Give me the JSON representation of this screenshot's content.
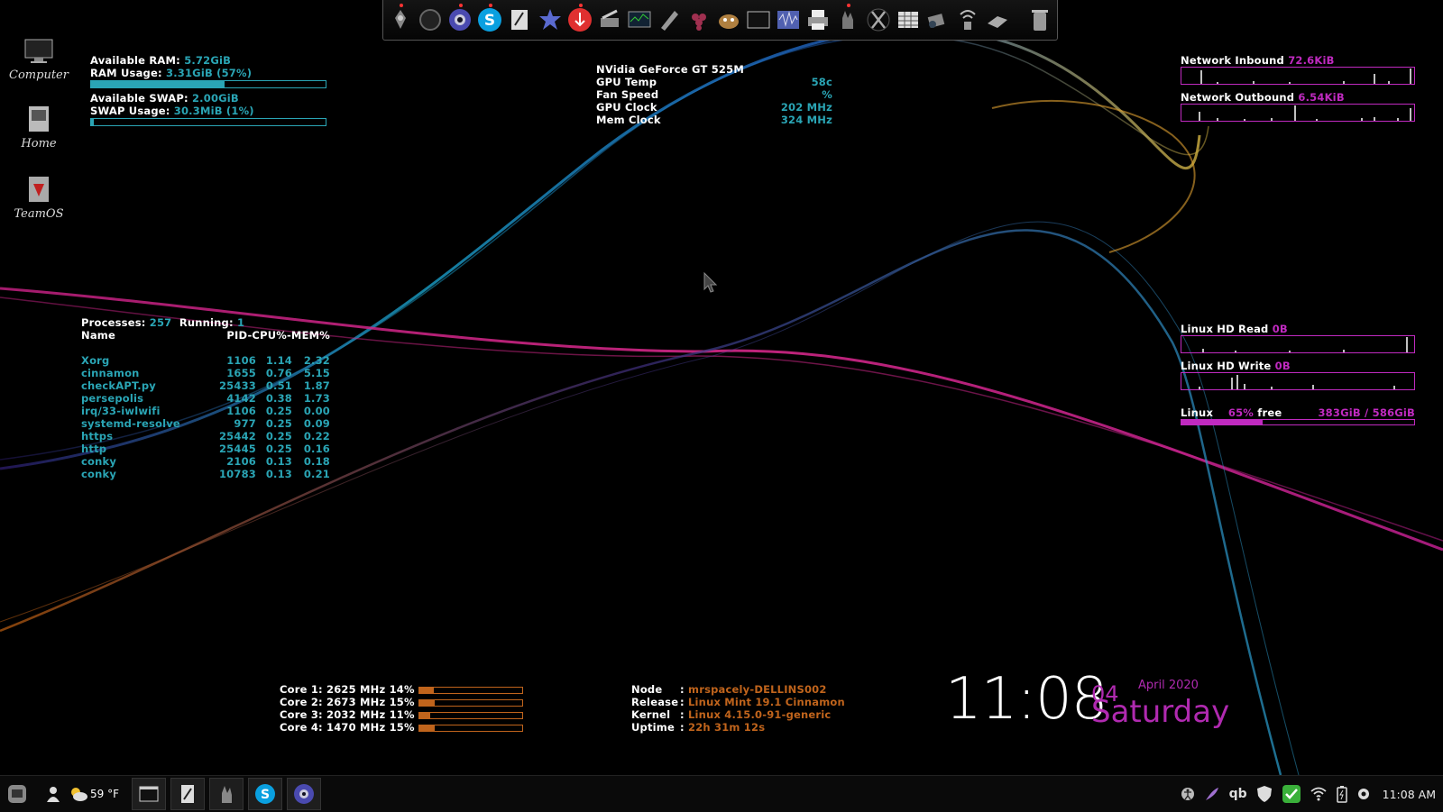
{
  "desktop": {
    "icons": [
      {
        "label": "Computer"
      },
      {
        "label": "Home"
      },
      {
        "label": "TeamOS"
      }
    ]
  },
  "memory": {
    "available_ram_label": "Available RAM:",
    "available_ram_value": "5.72GiB",
    "ram_usage_label": "RAM Usage:",
    "ram_usage_value": "3.31GiB (57%)",
    "ram_usage_percent": 57,
    "available_swap_label": "Available SWAP:",
    "available_swap_value": "2.00GiB",
    "swap_usage_label": "SWAP Usage:",
    "swap_usage_value": "30.3MiB (1%)",
    "swap_usage_percent": 1
  },
  "gpu": {
    "name": "NVidia GeForce GT 525M",
    "rows": [
      {
        "label": "GPU Temp",
        "value": "58c"
      },
      {
        "label": "Fan Speed",
        "value": "%"
      },
      {
        "label": "GPU Clock",
        "value": "202 MHz"
      },
      {
        "label": "Mem Clock",
        "value": "324 MHz"
      }
    ]
  },
  "processes": {
    "processes_label": "Processes:",
    "processes_value": "257",
    "running_label": "Running:",
    "running_value": "1",
    "header_name": "Name",
    "header_cols": "PID-CPU%-MEM%",
    "rows": [
      {
        "name": "Xorg",
        "pid": "1106",
        "cpu": "1.14",
        "mem": "2.32"
      },
      {
        "name": "cinnamon",
        "pid": "1655",
        "cpu": "0.76",
        "mem": "5.15"
      },
      {
        "name": "checkAPT.py",
        "pid": "25433",
        "cpu": "0.51",
        "mem": "1.87"
      },
      {
        "name": "persepolis",
        "pid": "4142",
        "cpu": "0.38",
        "mem": "1.73"
      },
      {
        "name": "irq/33-iwlwifi",
        "pid": "1106",
        "cpu": "0.25",
        "mem": "0.00"
      },
      {
        "name": "systemd-resolve",
        "pid": "977",
        "cpu": "0.25",
        "mem": "0.09"
      },
      {
        "name": "https",
        "pid": "25442",
        "cpu": "0.25",
        "mem": "0.22"
      },
      {
        "name": "http",
        "pid": "25445",
        "cpu": "0.25",
        "mem": "0.16"
      },
      {
        "name": "conky",
        "pid": "2106",
        "cpu": "0.13",
        "mem": "0.18"
      },
      {
        "name": "conky",
        "pid": "10783",
        "cpu": "0.13",
        "mem": "0.21"
      }
    ]
  },
  "network": {
    "inbound_label": "Network  Inbound",
    "inbound_value": "72.6KiB",
    "outbound_label": "Network Outbound",
    "outbound_value": "6.54KiB"
  },
  "disk": {
    "read_label": "Linux HD Read",
    "read_value": "0B",
    "write_label": "Linux HD Write",
    "write_value": "0B",
    "fs_label": "Linux",
    "fs_free_percent_text": "65%",
    "fs_free_word": "free",
    "fs_usage": "383GiB / 586GiB",
    "fs_used_percent": 35
  },
  "cpu": {
    "cores": [
      {
        "label": "Core 1: 2625 MHz 14%",
        "percent": 14
      },
      {
        "label": "Core 2: 2673 MHz 15%",
        "percent": 15
      },
      {
        "label": "Core 3: 2032 MHz 11%",
        "percent": 11
      },
      {
        "label": "Core 4: 1470 MHz 15%",
        "percent": 15
      }
    ]
  },
  "system": {
    "rows": [
      {
        "label": "Node",
        "value": "mrspacely-DELLINS002"
      },
      {
        "label": "Release",
        "value": "Linux Mint 19.1 Cinnamon"
      },
      {
        "label": "Kernel",
        "value": "Linux 4.15.0-91-generic"
      },
      {
        "label": "Uptime",
        "value": "22h 31m 12s"
      }
    ]
  },
  "clock": {
    "time": "11:08",
    "day": "04",
    "month_year": "April 2020",
    "weekday": "Saturday"
  },
  "panel": {
    "weather": "59 °F",
    "time": "11:08 AM",
    "tray_qb": "qb"
  },
  "colors": {
    "cyan": "#2aa5b5",
    "magenta": "#c02ac0",
    "orange": "#c0641c"
  }
}
